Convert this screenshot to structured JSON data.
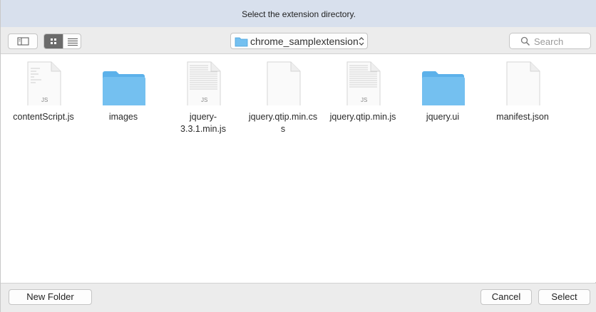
{
  "dialog": {
    "title": "Select the extension directory."
  },
  "toolbar": {
    "path_label": "chrome_samplextension",
    "search_placeholder": "Search"
  },
  "files": [
    {
      "name": "contentScript.js",
      "kind": "js-document",
      "badge": "JS"
    },
    {
      "name": "images",
      "kind": "folder"
    },
    {
      "name": "jquery-3.3.1.min.js",
      "kind": "js-document",
      "badge": "JS"
    },
    {
      "name": "jquery.qtip.min.css",
      "kind": "blank-document"
    },
    {
      "name": "jquery.qtip.min.js",
      "kind": "js-document",
      "badge": "JS"
    },
    {
      "name": "jquery.ui",
      "kind": "folder"
    },
    {
      "name": "manifest.json",
      "kind": "blank-document"
    }
  ],
  "footer": {
    "new_folder_label": "New Folder",
    "cancel_label": "Cancel",
    "select_label": "Select"
  },
  "colors": {
    "folder": "#74c0f0",
    "titlebar": "#d8e0ed"
  }
}
